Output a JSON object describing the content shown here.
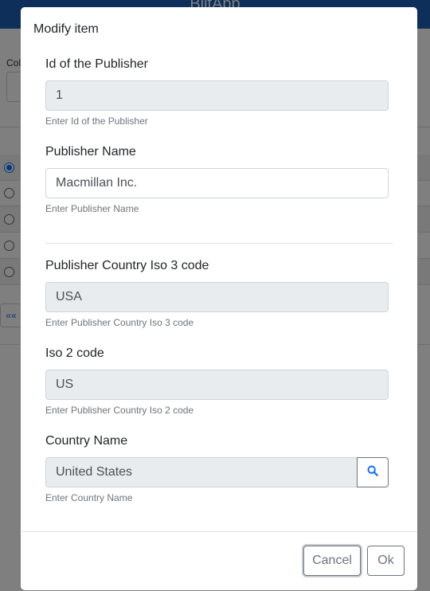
{
  "background": {
    "app_title": "BlitApp",
    "column_label": "Col",
    "pager_first": "««"
  },
  "modal": {
    "title": "Modify item",
    "fields": [
      {
        "label": "Id of the Publisher",
        "value": "1",
        "help": "Enter Id of the Publisher",
        "readonly": true
      },
      {
        "label": "Publisher Name",
        "value": "Macmillan Inc.",
        "help": "Enter Publisher Name",
        "readonly": false
      },
      {
        "label": "Publisher Country Iso 3 code",
        "value": "USA",
        "help": "Enter Publisher Country Iso 3 code",
        "readonly": true
      },
      {
        "label": "Iso 2 code",
        "value": "US",
        "help": "Enter Publisher Country Iso 2 code",
        "readonly": true
      },
      {
        "label": "Country Name",
        "value": "United States",
        "help": "Enter Country Name",
        "readonly": true
      }
    ],
    "search_icon": "search-icon",
    "cancel_label": "Cancel",
    "ok_label": "Ok"
  },
  "colors": {
    "header": "#1a5fb4",
    "search_icon": "#0d6efd",
    "readonly_bg": "#e9ecef"
  }
}
